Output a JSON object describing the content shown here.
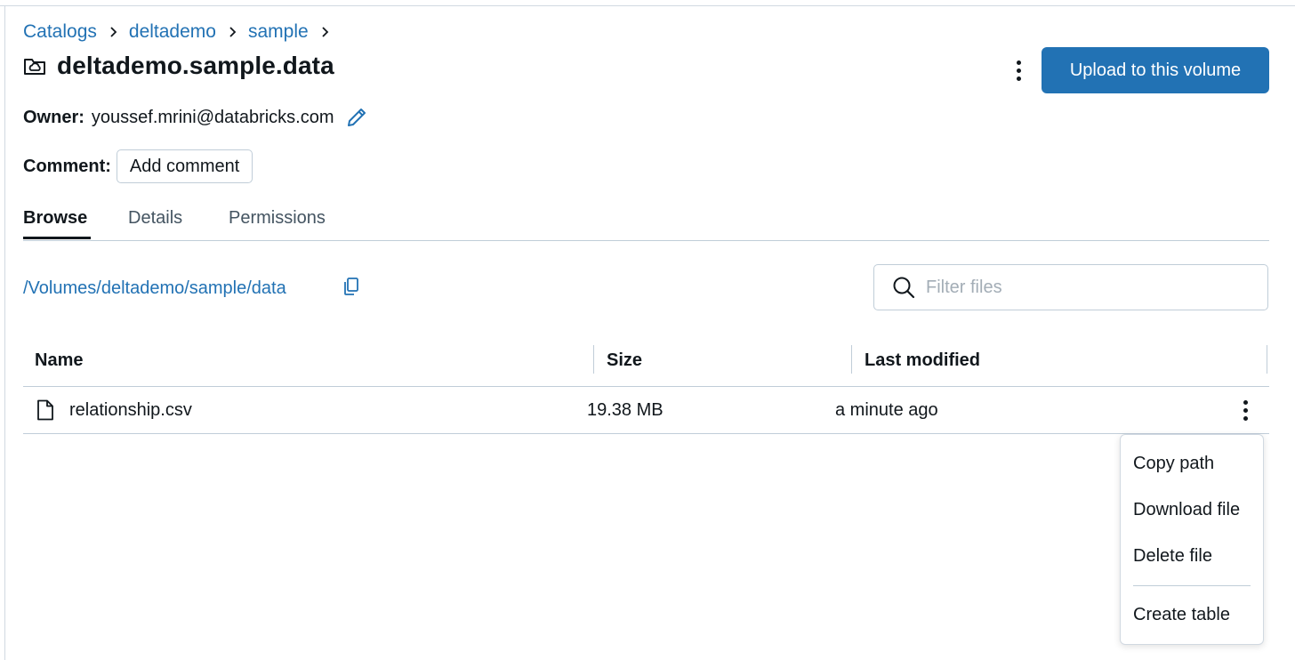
{
  "breadcrumb": {
    "items": [
      "Catalogs",
      "deltademo",
      "sample"
    ]
  },
  "header": {
    "title": "deltademo.sample.data",
    "title_icon": "volume-folder-icon",
    "upload_label": "Upload to this volume"
  },
  "owner": {
    "label": "Owner:",
    "value": "youssef.mrini@databricks.com"
  },
  "comment": {
    "label": "Comment:",
    "button_label": "Add comment"
  },
  "tabs": [
    {
      "label": "Browse",
      "active": true
    },
    {
      "label": "Details",
      "active": false
    },
    {
      "label": "Permissions",
      "active": false
    }
  ],
  "path": {
    "value": "/Volumes/deltademo/sample/data"
  },
  "filter": {
    "placeholder": "Filter files"
  },
  "table": {
    "columns": [
      "Name",
      "Size",
      "Last modified"
    ],
    "rows": [
      {
        "name": "relationship.csv",
        "size": "19.38 MB",
        "modified": "a minute ago"
      }
    ]
  },
  "context_menu": {
    "items": [
      "Copy path",
      "Download file",
      "Delete file",
      "Create table"
    ]
  },
  "colors": {
    "accent": "#2272b4",
    "text": "#11171c",
    "border": "#c0cdd8"
  }
}
